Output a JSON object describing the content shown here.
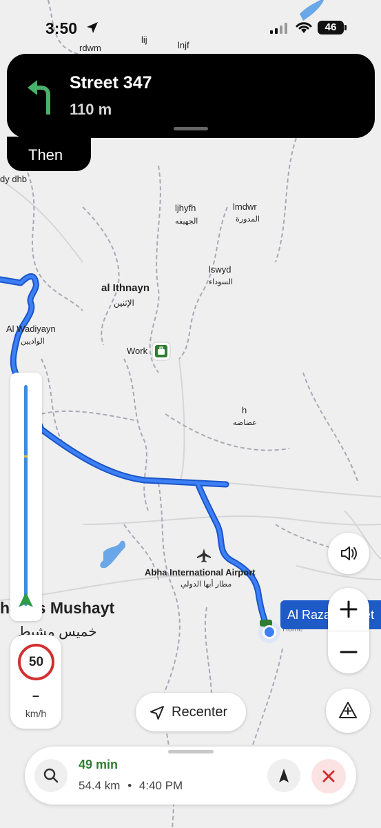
{
  "status_bar": {
    "time": "3:50",
    "battery": "46"
  },
  "navigation": {
    "maneuver_icon": "turn-left-arrow-icon",
    "street": "Street 347",
    "distance": "110 m",
    "then_label": "Then"
  },
  "map": {
    "labels": {
      "rdwm": "rdwm",
      "lij": "lij",
      "lnjf": "lnjf",
      "dy_dhb": "dy dhb",
      "ljhyfh": "ljhyfh",
      "ljhyfh_ar": "الجهيفه",
      "lmdwr": "lmdwr",
      "lmdwr_ar": "المدورة",
      "lswyd": "lswyd",
      "lswyd_ar": "السوداء",
      "al_ithnayn": "al Ithnayn",
      "al_ithnayn_ar": "الإثنين",
      "al_wadiyayn": "Al Wadiyayn",
      "al_wadiyayn_ar": "الواديين",
      "work": "Work",
      "h": "h",
      "h_ar": "عضاضه",
      "airport": "Abha International Airport",
      "airport_ar": "مطار أبها الدولي",
      "city": "hamis Mushayt",
      "city_ar": "خميس مشيط",
      "destination": "Al Razan Street",
      "home": "Home"
    },
    "route_color": "#3d7ff5",
    "route_outline_color": "#1a55c8"
  },
  "speed": {
    "limit": "50",
    "current": "–",
    "unit": "km/h"
  },
  "controls": {
    "recenter_label": "Recenter",
    "sound_icon": "speaker-icon",
    "zoom_in_icon": "plus-icon",
    "zoom_out_icon": "minus-icon",
    "report_icon": "report-warning-icon"
  },
  "trip": {
    "eta_duration": "49 min",
    "distance": "54.4 km",
    "separator": "•",
    "arrival_time": "4:40 PM",
    "eta_color": "#2e7d32"
  }
}
